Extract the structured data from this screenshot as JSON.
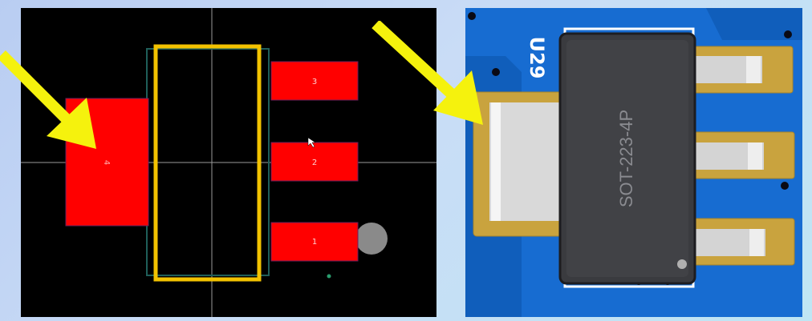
{
  "footprint_view": {
    "pads": [
      {
        "number": "4"
      },
      {
        "number": "3"
      },
      {
        "number": "2"
      },
      {
        "number": "1"
      }
    ],
    "colors": {
      "background": "#000000",
      "pad": "#ff0000",
      "pad_outline": "#6b1f5c",
      "silkscreen": "#f2c200",
      "courtyard": "#1f5f5a",
      "crosshair": "#9a9a9a",
      "pin1_marker": "#8a8a8a"
    },
    "icons": [
      "mouse-cursor-icon",
      "pin1-marker-icon",
      "origin-dot-icon"
    ]
  },
  "model_view": {
    "reference_designator": "U29",
    "package_label": "SOT-223-4P",
    "colors": {
      "board": "#0d5ec0",
      "copper_pad": "#c9a33e",
      "lead": "#d6d6d6",
      "body": "#3a3b3f",
      "silkscreen_white": "#ffffff"
    }
  },
  "annotations": {
    "arrow_color": "#f5f20d",
    "icons": [
      "callout-arrow-icon",
      "callout-arrow-icon"
    ]
  }
}
